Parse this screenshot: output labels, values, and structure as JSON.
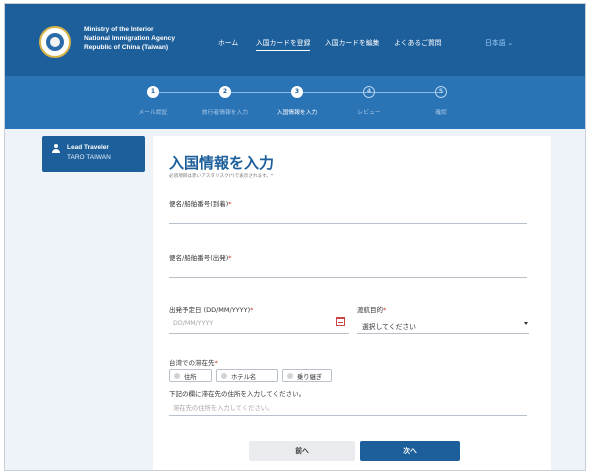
{
  "header": {
    "agency_lines": [
      "Ministry of the Interior",
      "National Immigration Agency",
      "Republic of China (Taiwan)"
    ],
    "nav": [
      "ホーム",
      "入国カードを登録",
      "入国カードを編集",
      "よくあるご質問"
    ],
    "language": "日本語 ⌄",
    "brand_color": "#1d5f9b"
  },
  "stepper": {
    "steps": [
      {
        "number": "1",
        "label": "メール認証",
        "state": "done"
      },
      {
        "number": "2",
        "label": "旅行者情報を入力",
        "state": "done"
      },
      {
        "number": "3",
        "label": "入国情報を入力",
        "state": "current"
      },
      {
        "number": "4",
        "label": "レビュー",
        "state": "todo"
      },
      {
        "number": "5",
        "label": "確認",
        "state": "todo"
      }
    ]
  },
  "sidebar": {
    "title": "Lead Traveler",
    "name": "TARO TAIWAN"
  },
  "form": {
    "title": "入国情報を入力",
    "required_note": "必須項目は赤いアスタリスク(*)で表示されます。*",
    "arrival_flight_label": "便名/船舶番号(到着)",
    "departure_flight_label": "便名/船舶番号(出発)",
    "departure_date_label": "出発予定日 (DD/MM/YYYY)",
    "departure_date_placeholder": "DD/MM/YYYY",
    "purpose_label": "渡航目的",
    "purpose_value": "選択してください",
    "stay_label": "台湾での滞在先",
    "stay_options": [
      "住所",
      "ホテル名",
      "乗り継ぎ"
    ],
    "stay_instruction": "下記の欄に滞在先の住所を入力してください。",
    "stay_placeholder": "滞在先の住所を入力してください。",
    "required_mark": "*"
  },
  "buttons": {
    "prev": "前へ",
    "next": "次へ"
  }
}
